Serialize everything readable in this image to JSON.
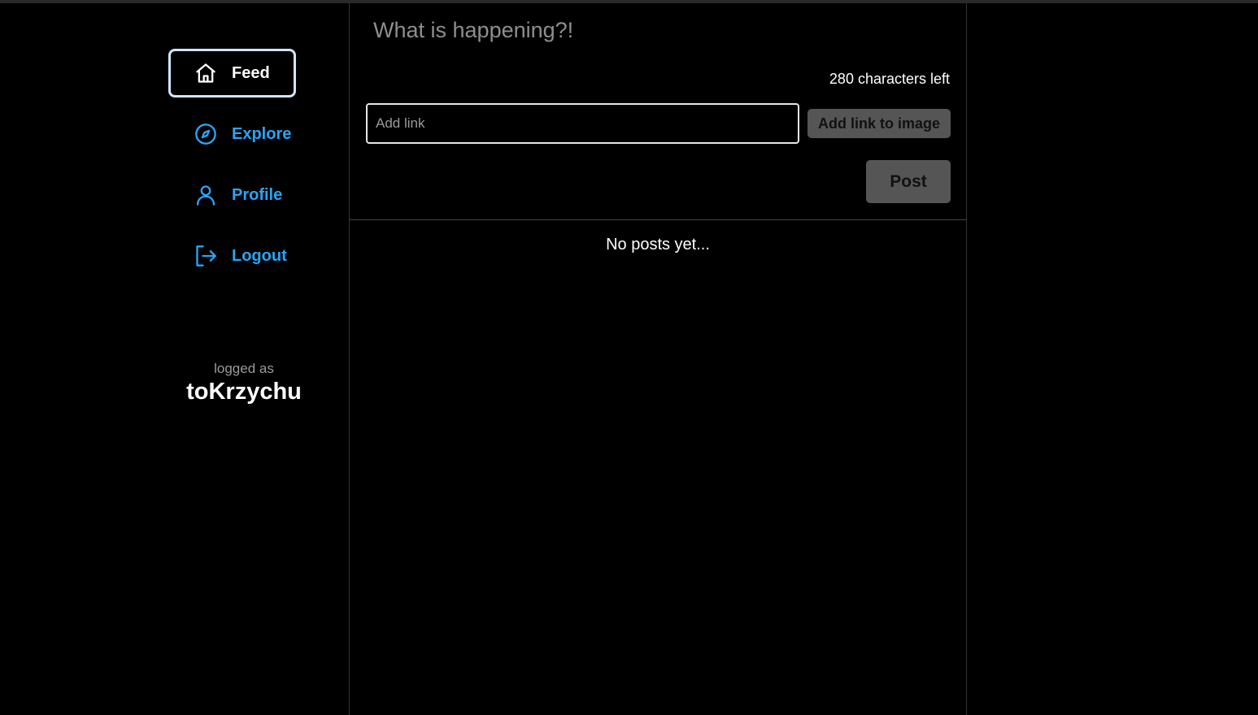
{
  "sidebar": {
    "items": [
      {
        "label": "Feed",
        "icon": "home-icon",
        "active": true
      },
      {
        "label": "Explore",
        "icon": "compass-icon",
        "active": false
      },
      {
        "label": "Profile",
        "icon": "user-icon",
        "active": false
      },
      {
        "label": "Logout",
        "icon": "logout-icon",
        "active": false
      }
    ],
    "logged_label": "logged as",
    "username": "toKrzychu"
  },
  "composer": {
    "placeholder": "What is happening?!",
    "chars_left": "280 characters left",
    "link_placeholder": "Add link",
    "link_value": "",
    "add_link_label": "Add link to image",
    "post_label": "Post"
  },
  "feed": {
    "empty_text": "No posts yet..."
  },
  "colors": {
    "background": "#000000",
    "accent": "#2aa4f4",
    "active_border": "#cfe6ff",
    "button_bg": "#555555",
    "muted_text": "#8e8e8e"
  }
}
